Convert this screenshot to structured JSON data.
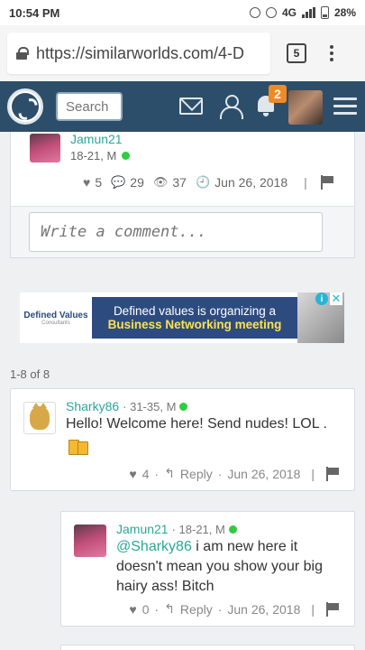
{
  "statusbar": {
    "time": "10:54 PM",
    "network": "4G",
    "battery": "28%"
  },
  "browser": {
    "url": "https://similarworlds.com/4-D",
    "tab_count": "5"
  },
  "header": {
    "search_placeholder": "Search",
    "notification_count": "2"
  },
  "post": {
    "author": "Jamun21",
    "author_meta": "18-21, M",
    "likes": "5",
    "comments": "29",
    "views": "37",
    "date": "Jun 26, 2018",
    "comment_placeholder": "Write a comment..."
  },
  "ad": {
    "brand": "Defined Values",
    "brand_sub": "Consultants",
    "line1": "Defined values is organizing a",
    "line2": "Business Networking meeting"
  },
  "comment_count": "1-8 of 8",
  "comments": [
    {
      "author": "Sharky86",
      "meta": "· 31-35, M",
      "text": "Hello! Welcome here! Send nudes! LOL .",
      "likes": "4",
      "reply": "Reply",
      "date": "Jun 26, 2018"
    },
    {
      "author": "Jamun21",
      "meta": "· 18-21, M",
      "mention": "@Sharky86",
      "text": " i am new here it doesn't mean you show your big hairy ass! Bitch",
      "likes": "0",
      "reply": "Reply",
      "date": "Jun 26, 2018"
    }
  ],
  "colors": {
    "header_bg": "#2d4e6a",
    "link": "#2aa898",
    "badge": "#f08a24",
    "online": "#2ecc40"
  }
}
